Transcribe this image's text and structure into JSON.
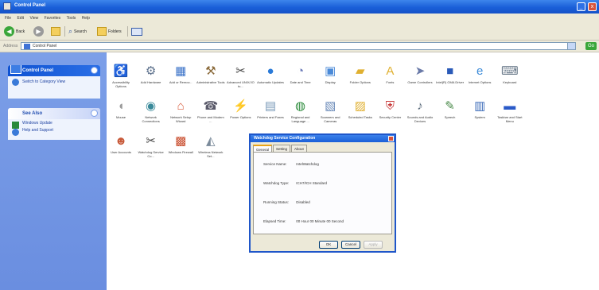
{
  "window": {
    "title": "Control Panel",
    "minimize": "_",
    "close": "x"
  },
  "menu": [
    "File",
    "Edit",
    "View",
    "Favorites",
    "Tools",
    "Help"
  ],
  "toolbar": {
    "back": "Back",
    "search": "Search",
    "folders": "Folders"
  },
  "address": {
    "label": "Address",
    "value": "Control Panel",
    "go": "Go"
  },
  "sidebar": {
    "panel1_title": "Control Panel",
    "switch_view": "Switch to Category View",
    "panel2_title": "See Also",
    "windows_update": "Windows Update",
    "help_support": "Help and Support"
  },
  "items": [
    {
      "label": "Accessibility Options",
      "icon": "accessibility-icon",
      "color": "#2a8a3a"
    },
    {
      "label": "Add Hardware",
      "icon": "hardware-icon",
      "color": "#5a6e8a"
    },
    {
      "label": "Add or Remov...",
      "icon": "add-remove-icon",
      "color": "#3a72c8"
    },
    {
      "label": "Administrative Tools",
      "icon": "admin-tools-icon",
      "color": "#8a6a3a"
    },
    {
      "label": "Advanced UNIX/JO to...",
      "icon": "advanced-icon",
      "color": "#4a4a4a"
    },
    {
      "label": "Automatic Updates",
      "icon": "globe-icon",
      "color": "#2a7ad8"
    },
    {
      "label": "Date and Time",
      "icon": "clock-icon",
      "color": "#6a7ab8"
    },
    {
      "label": "Display",
      "icon": "display-icon",
      "color": "#4a8ad8"
    },
    {
      "label": "Folder Options",
      "icon": "folder-icon",
      "color": "#e0b030"
    },
    {
      "label": "Fonts",
      "icon": "fonts-icon",
      "color": "#e0b030"
    },
    {
      "label": "Game Controllers",
      "icon": "game-icon",
      "color": "#6a7aa8"
    },
    {
      "label": "Intel(R) GMA Driver",
      "icon": "intel-icon",
      "color": "#2a5ab8"
    },
    {
      "label": "Internet Options",
      "icon": "ie-icon",
      "color": "#3a8ad8"
    },
    {
      "label": "Keyboard",
      "icon": "keyboard-icon",
      "color": "#6a7a8a"
    },
    {
      "label": "Mouse",
      "icon": "mouse-icon",
      "color": "#9a9a9a"
    },
    {
      "label": "Network Connections",
      "icon": "network-icon",
      "color": "#3a8a9a"
    },
    {
      "label": "Network Setup Wizard",
      "icon": "network-wizard-icon",
      "color": "#d85a3a"
    },
    {
      "label": "Phone and Modem ...",
      "icon": "phone-icon",
      "color": "#5a5a6a"
    },
    {
      "label": "Power Options",
      "icon": "power-icon",
      "color": "#4a9a4a"
    },
    {
      "label": "Printers and Faxes",
      "icon": "printer-icon",
      "color": "#7a9ab8"
    },
    {
      "label": "Regional and Language ...",
      "icon": "regional-icon",
      "color": "#2a8a3a"
    },
    {
      "label": "Scanners and Cameras",
      "icon": "scanner-icon",
      "color": "#6a8ab8"
    },
    {
      "label": "Scheduled Tasks",
      "icon": "tasks-icon",
      "color": "#e0b030"
    },
    {
      "label": "Security Center",
      "icon": "shield-icon",
      "color": "#c83a3a"
    },
    {
      "label": "Sounds and Audio Devices",
      "icon": "sound-icon",
      "color": "#5a6a7a"
    },
    {
      "label": "Speech",
      "icon": "speech-icon",
      "color": "#4a8a4a"
    },
    {
      "label": "System",
      "icon": "system-icon",
      "color": "#3a6ab8"
    },
    {
      "label": "Taskbar and Start Menu",
      "icon": "taskbar-icon",
      "color": "#2a5ac8"
    },
    {
      "label": "User Accounts",
      "icon": "users-icon",
      "color": "#c85a3a"
    },
    {
      "label": "Watchdog Service Co...",
      "icon": "watchdog-icon",
      "color": "#4a4a4a"
    },
    {
      "label": "Windows Firewall",
      "icon": "firewall-icon",
      "color": "#c84a2a"
    },
    {
      "label": "Wireless Network Set...",
      "icon": "wireless-icon",
      "color": "#7a8a9a"
    }
  ],
  "dialog": {
    "title": "Watchdog Service Configuration",
    "tabs": [
      "General",
      "Setting",
      "About"
    ],
    "fields": [
      {
        "k": "Service Name:",
        "v": "IntelWatchdog"
      },
      {
        "k": "Watchdog Type:",
        "v": "ICH7/ICH Standard"
      },
      {
        "k": "Running Status:",
        "v": "Disabled"
      },
      {
        "k": "Elapsed Time:",
        "v": "00 Hour 00 Minute 00 Second"
      }
    ],
    "ok": "OK",
    "cancel": "Cancel",
    "apply": "Apply"
  }
}
